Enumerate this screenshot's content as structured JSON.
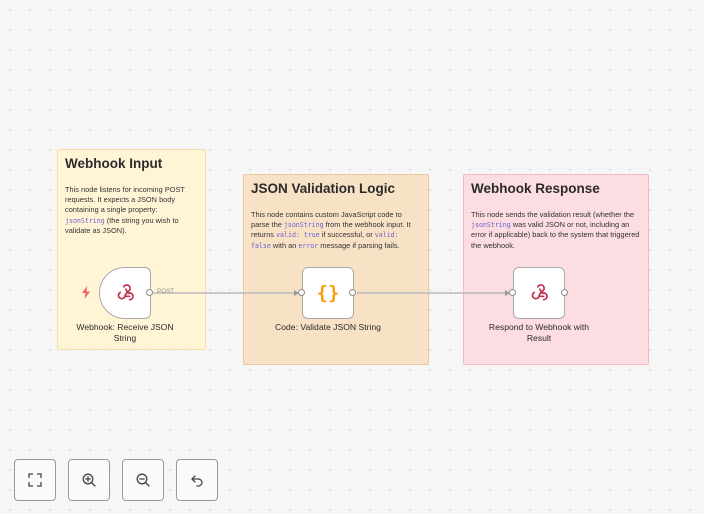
{
  "notes": [
    {
      "title": "Webhook Input",
      "body": [
        {
          "t": "This node listens for incoming POST requests. It expects a JSON body containing a single property: "
        },
        {
          "t": "jsonString",
          "code": true
        },
        {
          "t": " (the string you wish to validate as JSON)."
        }
      ]
    },
    {
      "title": "JSON Validation Logic",
      "body": [
        {
          "t": "This node contains custom JavaScript code to parse the "
        },
        {
          "t": "jsonString",
          "code": true
        },
        {
          "t": " from the webhook input. It returns "
        },
        {
          "t": "valid: true",
          "code": true
        },
        {
          "t": " if successful, or "
        },
        {
          "t": "valid: false",
          "code": true
        },
        {
          "t": " with an "
        },
        {
          "t": "error",
          "code": true
        },
        {
          "t": " message if parsing fails."
        }
      ]
    },
    {
      "title": "Webhook Response",
      "body": [
        {
          "t": "This node sends the validation result (whether the "
        },
        {
          "t": "jsonString",
          "code": true
        },
        {
          "t": " was valid JSON or not, including an error if applicable) back to the system that triggered the webhook."
        }
      ]
    }
  ],
  "nodes": {
    "webhook": {
      "label": "Webhook: Receive JSON String",
      "icon": "webhook-icon"
    },
    "code": {
      "label": "Code: Validate JSON String",
      "icon": "code-braces-icon"
    },
    "respond": {
      "label": "Respond to Webhook with Result",
      "icon": "webhook-icon"
    }
  },
  "connections": {
    "webhook_to_code_label": "POST"
  },
  "controls": [
    {
      "name": "fit-view-button",
      "icon": "fit-view-icon"
    },
    {
      "name": "zoom-in-button",
      "icon": "zoom-in-icon"
    },
    {
      "name": "zoom-out-button",
      "icon": "zoom-out-icon"
    },
    {
      "name": "reset-zoom-button",
      "icon": "undo-icon"
    }
  ],
  "colors": {
    "webhook_icon": "#c3304f",
    "code_icon": "#f59e0b",
    "trigger_bolt": "#f06262",
    "link": "#b9b9b9"
  }
}
